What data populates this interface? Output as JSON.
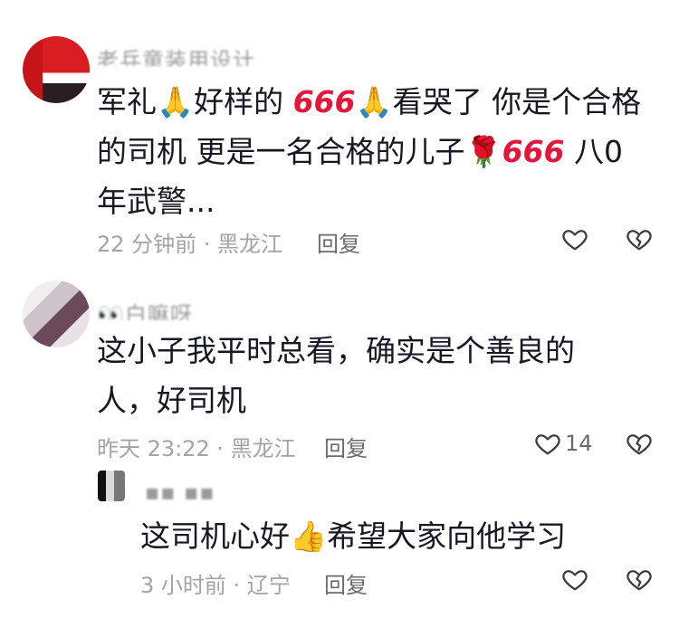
{
  "comments": [
    {
      "username": "老兵童装用设计",
      "text": "军礼🙏好样的 666🙏看哭了  你是是个合格的司机  更是一名合格的儿子🌹666  八0年武警...",
      "line1": "军礼🙏好样的 ",
      "line1_b": "666",
      "line1_c": "🙏看哭了  你是个合格",
      "line2": "的司机  更是一名合格的儿子",
      "line2_b": "🌹",
      "line2_c": "666",
      "line2_d": "  八0",
      "line3": "年武警...",
      "meta": "22 分钟前 · 黑龙江",
      "reply": "回复",
      "likes": ""
    },
    {
      "username": "👀白嘛呀",
      "line1": "这小子我平时总看，确实是个善良的",
      "line2": "人，好司机",
      "meta": "昨天 23:22 · 黑龙江",
      "reply": "回复",
      "likes": "14"
    },
    {
      "username": "▪▪ ▪▪",
      "line1": "这司机心好",
      "line1_b": "👍",
      "line1_c": "希望大家向他学习",
      "meta": "3 小时前 · 辽宁",
      "reply": "回复",
      "likes": ""
    }
  ],
  "icons": {
    "like": "heart-outline-icon",
    "dislike": "broken-heart-icon"
  },
  "colors": {
    "text": "#161823",
    "meta": "#a3a3a8",
    "reply": "#6a6a72",
    "accent_666": "#e4163a"
  }
}
